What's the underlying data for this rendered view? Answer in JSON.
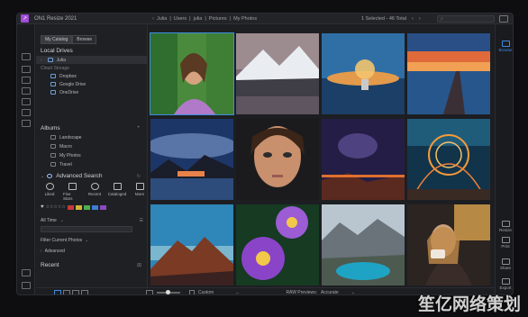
{
  "app": {
    "title": "ON1 Resize 2021"
  },
  "breadcrumbs": [
    "Julia",
    "Users",
    "julia",
    "Pictures",
    "My Photos"
  ],
  "selection_info": "1 Selected - 46 Total",
  "search": {
    "placeholder": ""
  },
  "sidebar": {
    "tabs": [
      "My Catalog",
      "Browse"
    ],
    "local_drives_title": "Local Drives",
    "local_drives": [
      {
        "label": "Julia",
        "selected": true
      }
    ],
    "cloud_storage_label": "Cloud Storage",
    "cloud_items": [
      "Dropbox",
      "Google Drive",
      "OneDrive"
    ],
    "albums_title": "Albums",
    "albums": [
      "Landscape",
      "Macro",
      "My Photos",
      "Travel"
    ],
    "advanced_search_title": "Advanced Search",
    "quick_filters": [
      "Liked",
      "Five Stars",
      "Recent",
      "Cataloged",
      "More"
    ],
    "filter_colors": [
      "#c23a3a",
      "#d0b43a",
      "#4caf50",
      "#3d7fd6",
      "#8a4bc2"
    ],
    "time_filter": "All Time",
    "filter_current": "Filter Current Photos",
    "advanced": "Advanced",
    "recent_title": "Recent"
  },
  "grid": {
    "photos": [
      {
        "name": "woman-green-leaves",
        "selected": true
      },
      {
        "name": "snow-mountain-lake",
        "selected": false
      },
      {
        "name": "lightbulb-sunset",
        "selected": false
      },
      {
        "name": "pier-sunset",
        "selected": false
      },
      {
        "name": "milky-way-lake",
        "selected": false
      },
      {
        "name": "woman-portrait",
        "selected": false
      },
      {
        "name": "galaxy-canyon",
        "selected": false
      },
      {
        "name": "light-painting",
        "selected": false
      },
      {
        "name": "mountain-sunset",
        "selected": false
      },
      {
        "name": "purple-flowers",
        "selected": false
      },
      {
        "name": "mountain-lake-aerial",
        "selected": false
      },
      {
        "name": "woman-coffee",
        "selected": false
      }
    ]
  },
  "right_panel": {
    "items": [
      "Browse",
      "Resize",
      "Print",
      "Share",
      "Export"
    ],
    "active": "Browse"
  },
  "bottom_bar": {
    "view": "Custom",
    "raw_previews_label": "RAW Previews:",
    "raw_previews_value": "Accurate"
  },
  "watermark": "笙亿网络策划"
}
